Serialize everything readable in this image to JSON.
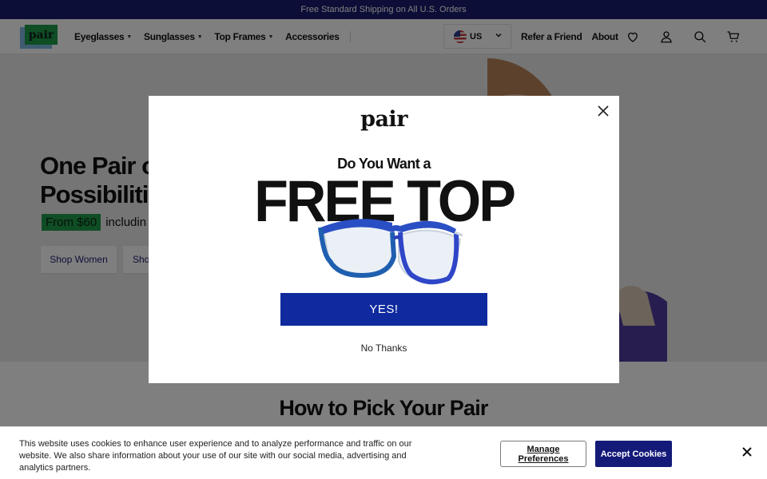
{
  "promo_bar": {
    "text": "Free Standard Shipping on All U.S. Orders"
  },
  "header": {
    "logo_text": "pair",
    "nav": [
      {
        "label": "Eyeglasses",
        "has_dropdown": true
      },
      {
        "label": "Sunglasses",
        "has_dropdown": true
      },
      {
        "label": "Top Frames",
        "has_dropdown": true
      },
      {
        "label": "Accessories",
        "has_dropdown": false
      }
    ],
    "country": {
      "code": "US",
      "icon": "us-flag-icon"
    },
    "links": [
      "Refer a Friend",
      "About"
    ],
    "icons": [
      "heart-icon",
      "account-icon",
      "search-icon",
      "cart-icon"
    ]
  },
  "hero": {
    "title_line1": "One Pair of",
    "title_line2": "Possibilitie",
    "price_badge": "From $60",
    "price_suffix": "includin",
    "button_women": "Shop Women",
    "button_men_partial": "Sho"
  },
  "section": {
    "title": "How to Pick Your Pair"
  },
  "modal": {
    "logo_text": "pair",
    "kicker": "Do You Want a",
    "headline": "FREE TOP",
    "yes_label": "YES!",
    "no_label": "No Thanks",
    "close_icon": "close-icon"
  },
  "cookie_banner": {
    "text": "This website uses cookies to enhance user experience and to analyze performance and traffic on our website. We also share information about your use of our site with our social media, advertising and analytics partners.",
    "manage_label": "Manage Preferences",
    "accept_label": "Accept Cookies",
    "close_icon": "close-icon"
  },
  "colors": {
    "promo_bg": "#1b1d6e",
    "brand_green": "#1f9a49",
    "yes_button": "#0f2a9e",
    "accept_button": "#141a78"
  }
}
